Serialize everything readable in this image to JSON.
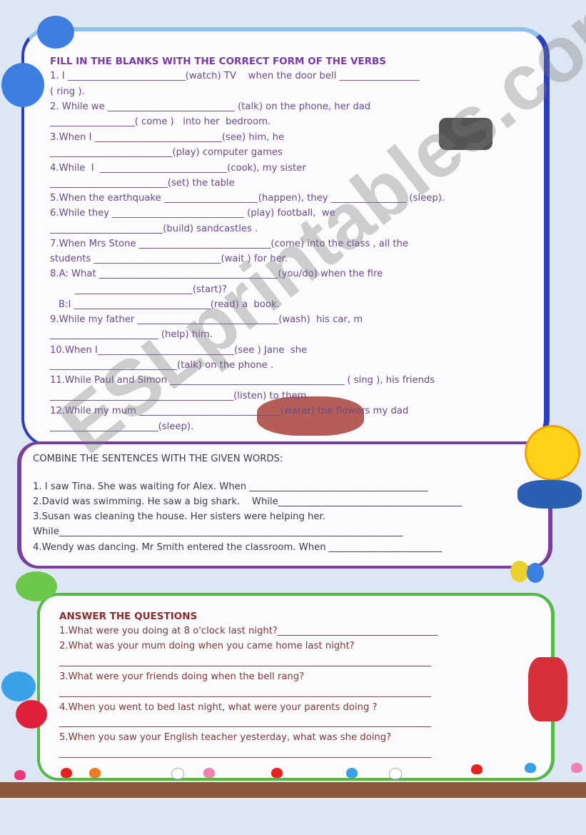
{
  "watermark": "ESLprintables.com",
  "section1": {
    "title": "FILL IN THE BLANKS WITH THE CORRECT FORM OF THE VERBS",
    "lines": [
      "1. I _________________________(watch) TV    when the door bell _________________",
      "( ring ).",
      "2. While we ___________________________ (talk) on the phone, her dad",
      "__________________( come )   into her  bedroom.",
      "3.When I ___________________________(see) him, he",
      "__________________________(play) computer games",
      "4.While  I  ___________________________(cook), my sister",
      "_________________________(set) the table",
      "5.When the earthquake ____________________(happen), they ________________ (sleep).",
      "6.While they ____________________________ (play) football,  we",
      "________________________(build) sandcastles .",
      "7.When Mrs Stone ____________________________(come) into the class , all the",
      "students ___________________________(wait ) for her.",
      "8.A: What ______________________________________(you/do) when the fire",
      "_________________________(start)?",
      "B:I _____________________________(read) a  book.",
      "9.While my father ______________________________(wash)  his car, m",
      "_______________________ (help) him.",
      "10.When I_____________________________(see ) Jane  she",
      "___________________________(talk) on the phone .",
      "11.While Paul and Simon _____________________________________ ( sing ), his friends",
      "_______________________________________(listen) to them",
      "12.While my mum ______________________________(water) the flowers my dad",
      "_______________________(sleep)."
    ]
  },
  "section2": {
    "title": "COMBINE THE SENTENCES WITH THE GIVEN WORDS:",
    "lines": [
      "1. I saw Tina. She was waiting for Alex. When ______________________________________",
      "2.David was swimming. He saw a big shark.    While_______________________________________",
      "3.Susan was cleaning the house. Her sisters were helping her.",
      "While_________________________________________________________________________",
      "4.Wendy was dancing. Mr Smith entered the classroom. When ________________________"
    ]
  },
  "section3": {
    "title": "ANSWER THE QUESTIONS",
    "lines": [
      "1.What were you doing at 8 o'clock last night?__________________________________",
      "2.What was your mum doing when you came home last night?",
      "_______________________________________________________________________________",
      "3.What were your friends doing when the bell rang?",
      "_______________________________________________________________________________",
      "4.When you went to bed last night, what were your parents doing ?",
      "_______________________________________________________________________________",
      "5.When you saw your English teacher yesterday, what was she doing?",
      "_______________________________________________________________________________"
    ]
  },
  "colors": {
    "box1_border": "#2c3fbf",
    "box2_border": "#7a3f9e",
    "box3_border": "#54b948",
    "section1_text": "#6a4a86",
    "section3_text": "#7a3838"
  }
}
